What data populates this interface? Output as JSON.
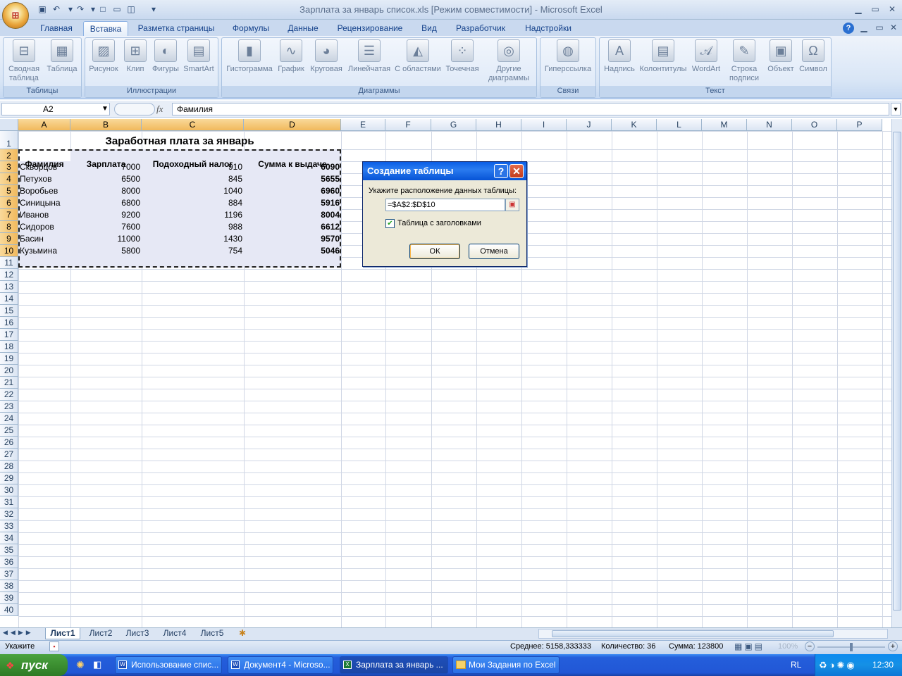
{
  "window": {
    "title": "Зарплата за январь список.xls  [Режим совместимости] - Microsoft Excel"
  },
  "tabs": [
    "Главная",
    "Вставка",
    "Разметка страницы",
    "Формулы",
    "Данные",
    "Рецензирование",
    "Вид",
    "Разработчик",
    "Надстройки"
  ],
  "active_tab": "Вставка",
  "ribbon": {
    "groups": [
      {
        "label": "Таблицы",
        "buttons": [
          "Сводная таблица",
          "Таблица"
        ]
      },
      {
        "label": "Иллюстрации",
        "buttons": [
          "Рисунок",
          "Клип",
          "Фигуры",
          "SmartArt"
        ]
      },
      {
        "label": "Диаграммы",
        "buttons": [
          "Гистограмма",
          "График",
          "Круговая",
          "Линейчатая",
          "С областями",
          "Точечная",
          "Другие диаграммы"
        ]
      },
      {
        "label": "Связи",
        "buttons": [
          "Гиперссылка"
        ]
      },
      {
        "label": "Текст",
        "buttons": [
          "Надпись",
          "Колонтитулы",
          "WordArt",
          "Строка подписи",
          "Объект",
          "Символ"
        ]
      }
    ]
  },
  "formula_bar": {
    "name_box": "A2",
    "fx": "fx",
    "content": "Фамилия"
  },
  "columns": [
    "A",
    "B",
    "C",
    "D",
    "E",
    "F",
    "G",
    "H",
    "I",
    "J",
    "K",
    "L",
    "M",
    "N",
    "O",
    "P"
  ],
  "sheet": {
    "title": "Заработная плата за январь",
    "headers": [
      "Фамилия",
      "Зарплата",
      "Подоходный налог",
      "Сумма к выдаче"
    ],
    "rows": [
      [
        "Скворцов",
        "7000",
        "910",
        "6090"
      ],
      [
        "Петухов",
        "6500",
        "845",
        "5655"
      ],
      [
        "Воробьев",
        "8000",
        "1040",
        "6960"
      ],
      [
        "Синицына",
        "6800",
        "884",
        "5916"
      ],
      [
        "Иванов",
        "9200",
        "1196",
        "8004"
      ],
      [
        "Сидоров",
        "7600",
        "988",
        "6612"
      ],
      [
        "Басин",
        "11000",
        "1430",
        "9570"
      ],
      [
        "Кузьмина",
        "5800",
        "754",
        "5046"
      ]
    ]
  },
  "dialog": {
    "title": "Создание таблицы",
    "prompt": "Укажите расположение данных таблицы:",
    "range_value": "=$A$2:$D$10",
    "checkbox_label": "Таблица с заголовками",
    "checkbox_checked": true,
    "ok": "ОК",
    "cancel": "Отмена"
  },
  "sheet_tabs": [
    "Лист1",
    "Лист2",
    "Лист3",
    "Лист4",
    "Лист5"
  ],
  "status": {
    "mode": "Укажите",
    "average": "Среднее: 5158,333333",
    "count": "Количество: 36",
    "sum": "Сумма: 123800",
    "zoom": "100%"
  },
  "taskbar": {
    "start": "пуск",
    "tasks": [
      "Использование спис...",
      "Документ4 - Microso...",
      "Зарплата за январь ...",
      "Мои Задания по Excel"
    ],
    "lang": "RL",
    "clock": "12:30"
  },
  "colors": {
    "ribbon_text": "#15428b",
    "selection_header": "#f1b95c",
    "range_fill": "#e6e8f5",
    "xp_blue": "#245edb"
  }
}
